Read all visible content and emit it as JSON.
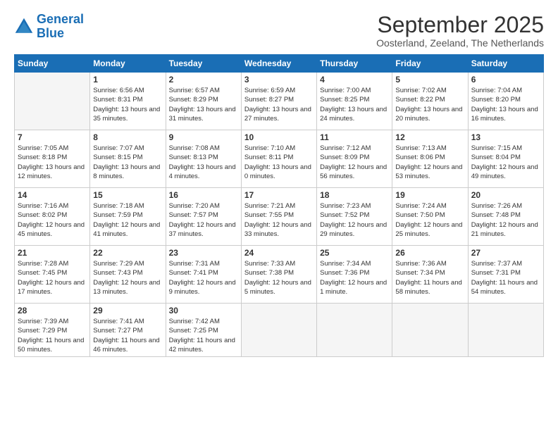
{
  "logo": {
    "line1": "General",
    "line2": "Blue"
  },
  "title": "September 2025",
  "subtitle": "Oosterland, Zeeland, The Netherlands",
  "days_of_week": [
    "Sunday",
    "Monday",
    "Tuesday",
    "Wednesday",
    "Thursday",
    "Friday",
    "Saturday"
  ],
  "weeks": [
    [
      {
        "day": "",
        "sunrise": "",
        "sunset": "",
        "daylight": "",
        "empty": true
      },
      {
        "day": "1",
        "sunrise": "Sunrise: 6:56 AM",
        "sunset": "Sunset: 8:31 PM",
        "daylight": "Daylight: 13 hours and 35 minutes."
      },
      {
        "day": "2",
        "sunrise": "Sunrise: 6:57 AM",
        "sunset": "Sunset: 8:29 PM",
        "daylight": "Daylight: 13 hours and 31 minutes."
      },
      {
        "day": "3",
        "sunrise": "Sunrise: 6:59 AM",
        "sunset": "Sunset: 8:27 PM",
        "daylight": "Daylight: 13 hours and 27 minutes."
      },
      {
        "day": "4",
        "sunrise": "Sunrise: 7:00 AM",
        "sunset": "Sunset: 8:25 PM",
        "daylight": "Daylight: 13 hours and 24 minutes."
      },
      {
        "day": "5",
        "sunrise": "Sunrise: 7:02 AM",
        "sunset": "Sunset: 8:22 PM",
        "daylight": "Daylight: 13 hours and 20 minutes."
      },
      {
        "day": "6",
        "sunrise": "Sunrise: 7:04 AM",
        "sunset": "Sunset: 8:20 PM",
        "daylight": "Daylight: 13 hours and 16 minutes."
      }
    ],
    [
      {
        "day": "7",
        "sunrise": "Sunrise: 7:05 AM",
        "sunset": "Sunset: 8:18 PM",
        "daylight": "Daylight: 13 hours and 12 minutes."
      },
      {
        "day": "8",
        "sunrise": "Sunrise: 7:07 AM",
        "sunset": "Sunset: 8:15 PM",
        "daylight": "Daylight: 13 hours and 8 minutes."
      },
      {
        "day": "9",
        "sunrise": "Sunrise: 7:08 AM",
        "sunset": "Sunset: 8:13 PM",
        "daylight": "Daylight: 13 hours and 4 minutes."
      },
      {
        "day": "10",
        "sunrise": "Sunrise: 7:10 AM",
        "sunset": "Sunset: 8:11 PM",
        "daylight": "Daylight: 13 hours and 0 minutes."
      },
      {
        "day": "11",
        "sunrise": "Sunrise: 7:12 AM",
        "sunset": "Sunset: 8:09 PM",
        "daylight": "Daylight: 12 hours and 56 minutes."
      },
      {
        "day": "12",
        "sunrise": "Sunrise: 7:13 AM",
        "sunset": "Sunset: 8:06 PM",
        "daylight": "Daylight: 12 hours and 53 minutes."
      },
      {
        "day": "13",
        "sunrise": "Sunrise: 7:15 AM",
        "sunset": "Sunset: 8:04 PM",
        "daylight": "Daylight: 12 hours and 49 minutes."
      }
    ],
    [
      {
        "day": "14",
        "sunrise": "Sunrise: 7:16 AM",
        "sunset": "Sunset: 8:02 PM",
        "daylight": "Daylight: 12 hours and 45 minutes."
      },
      {
        "day": "15",
        "sunrise": "Sunrise: 7:18 AM",
        "sunset": "Sunset: 7:59 PM",
        "daylight": "Daylight: 12 hours and 41 minutes."
      },
      {
        "day": "16",
        "sunrise": "Sunrise: 7:20 AM",
        "sunset": "Sunset: 7:57 PM",
        "daylight": "Daylight: 12 hours and 37 minutes."
      },
      {
        "day": "17",
        "sunrise": "Sunrise: 7:21 AM",
        "sunset": "Sunset: 7:55 PM",
        "daylight": "Daylight: 12 hours and 33 minutes."
      },
      {
        "day": "18",
        "sunrise": "Sunrise: 7:23 AM",
        "sunset": "Sunset: 7:52 PM",
        "daylight": "Daylight: 12 hours and 29 minutes."
      },
      {
        "day": "19",
        "sunrise": "Sunrise: 7:24 AM",
        "sunset": "Sunset: 7:50 PM",
        "daylight": "Daylight: 12 hours and 25 minutes."
      },
      {
        "day": "20",
        "sunrise": "Sunrise: 7:26 AM",
        "sunset": "Sunset: 7:48 PM",
        "daylight": "Daylight: 12 hours and 21 minutes."
      }
    ],
    [
      {
        "day": "21",
        "sunrise": "Sunrise: 7:28 AM",
        "sunset": "Sunset: 7:45 PM",
        "daylight": "Daylight: 12 hours and 17 minutes."
      },
      {
        "day": "22",
        "sunrise": "Sunrise: 7:29 AM",
        "sunset": "Sunset: 7:43 PM",
        "daylight": "Daylight: 12 hours and 13 minutes."
      },
      {
        "day": "23",
        "sunrise": "Sunrise: 7:31 AM",
        "sunset": "Sunset: 7:41 PM",
        "daylight": "Daylight: 12 hours and 9 minutes."
      },
      {
        "day": "24",
        "sunrise": "Sunrise: 7:33 AM",
        "sunset": "Sunset: 7:38 PM",
        "daylight": "Daylight: 12 hours and 5 minutes."
      },
      {
        "day": "25",
        "sunrise": "Sunrise: 7:34 AM",
        "sunset": "Sunset: 7:36 PM",
        "daylight": "Daylight: 12 hours and 1 minute."
      },
      {
        "day": "26",
        "sunrise": "Sunrise: 7:36 AM",
        "sunset": "Sunset: 7:34 PM",
        "daylight": "Daylight: 11 hours and 58 minutes."
      },
      {
        "day": "27",
        "sunrise": "Sunrise: 7:37 AM",
        "sunset": "Sunset: 7:31 PM",
        "daylight": "Daylight: 11 hours and 54 minutes."
      }
    ],
    [
      {
        "day": "28",
        "sunrise": "Sunrise: 7:39 AM",
        "sunset": "Sunset: 7:29 PM",
        "daylight": "Daylight: 11 hours and 50 minutes."
      },
      {
        "day": "29",
        "sunrise": "Sunrise: 7:41 AM",
        "sunset": "Sunset: 7:27 PM",
        "daylight": "Daylight: 11 hours and 46 minutes."
      },
      {
        "day": "30",
        "sunrise": "Sunrise: 7:42 AM",
        "sunset": "Sunset: 7:25 PM",
        "daylight": "Daylight: 11 hours and 42 minutes."
      },
      {
        "day": "",
        "sunrise": "",
        "sunset": "",
        "daylight": "",
        "empty": true
      },
      {
        "day": "",
        "sunrise": "",
        "sunset": "",
        "daylight": "",
        "empty": true
      },
      {
        "day": "",
        "sunrise": "",
        "sunset": "",
        "daylight": "",
        "empty": true
      },
      {
        "day": "",
        "sunrise": "",
        "sunset": "",
        "daylight": "",
        "empty": true
      }
    ]
  ]
}
